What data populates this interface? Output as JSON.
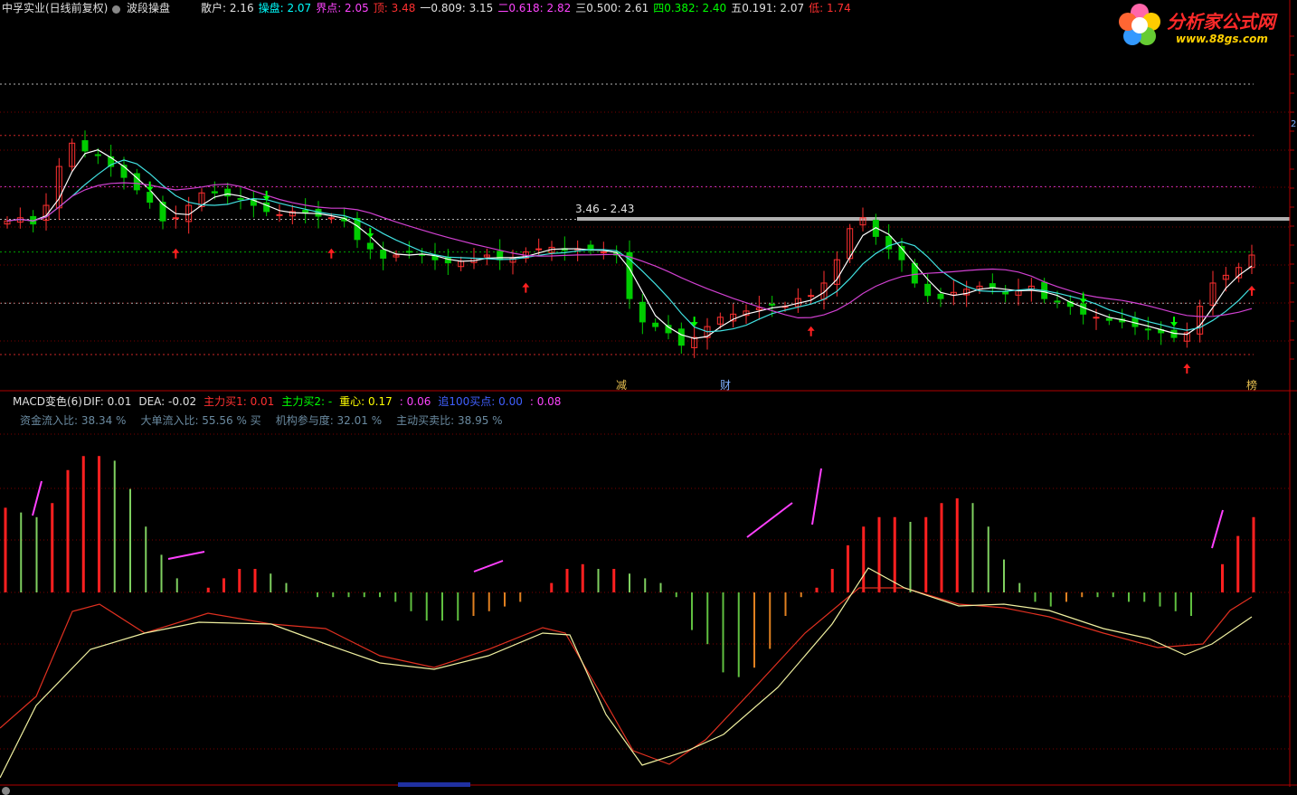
{
  "header": {
    "stock_title": "中孚实业(日线前复权)",
    "indicator_name": "波段操盘",
    "readouts": [
      {
        "label": "散户:",
        "value": "2.16",
        "color": "#e0e0e0"
      },
      {
        "label": "操盘:",
        "value": "2.07",
        "color": "#00ffff"
      },
      {
        "label": "界点:",
        "value": "2.05",
        "color": "#ff44ff"
      },
      {
        "label": "顶:",
        "value": "3.48",
        "color": "#ff3030"
      },
      {
        "label": "一0.809:",
        "value": "3.15",
        "color": "#e0e0e0"
      },
      {
        "label": "二0.618:",
        "value": "2.82",
        "color": "#ff44ff"
      },
      {
        "label": "三0.500:",
        "value": "2.61",
        "color": "#e0e0e0"
      },
      {
        "label": "四0.382:",
        "value": "2.40",
        "color": "#00ff00"
      },
      {
        "label": "五0.191:",
        "value": "2.07",
        "color": "#e0e0e0"
      },
      {
        "label": "低:",
        "value": "1.74",
        "color": "#ff3030"
      }
    ]
  },
  "logo": {
    "name": "分析家公式网",
    "url": "www.88gs.com"
  },
  "main_chart": {
    "annotation": "3.46 - 2.43",
    "markers": [
      "减",
      "财",
      "榜"
    ],
    "right_axis_tick": "2"
  },
  "sub_chart": {
    "title": "MACD变色(6)",
    "readouts": [
      {
        "label": "DIF:",
        "value": "0.01",
        "color": "#e0e0e0"
      },
      {
        "label": "DEA:",
        "value": "-0.02",
        "color": "#e0e0e0"
      },
      {
        "label": "主力买1:",
        "value": "0.01",
        "color": "#ff3030"
      },
      {
        "label": "主力买2:",
        "value": "-",
        "color": "#00ff00"
      },
      {
        "label": "重心:",
        "value": "0.17",
        "color": "#ffff00"
      },
      {
        "label": ":",
        "value": "0.06",
        "color": "#ff44ff"
      },
      {
        "label": "追100买点:",
        "value": "0.00",
        "color": "#4060ff"
      },
      {
        "label": ":",
        "value": "0.08",
        "color": "#ff44ff"
      }
    ],
    "stats": [
      {
        "label": "资金流入比:",
        "value": "38.34 %"
      },
      {
        "label": "大单流入比:",
        "value": "55.56 % 买"
      },
      {
        "label": "机构参与度:",
        "value": "32.01 %"
      },
      {
        "label": "主动买卖比:",
        "value": "38.95 %"
      }
    ]
  },
  "chart_data": [
    {
      "type": "candlestick",
      "title": "波段操盘",
      "fib_levels": [
        {
          "name": "顶",
          "value": 3.48
        },
        {
          "name": "一0.809",
          "value": 3.15
        },
        {
          "name": "二0.618",
          "value": 2.82
        },
        {
          "name": "三0.500",
          "value": 2.61
        },
        {
          "name": "四0.382",
          "value": 2.4
        },
        {
          "name": "五0.191",
          "value": 2.07
        },
        {
          "name": "低",
          "value": 1.74
        }
      ],
      "closes": [
        2.6,
        2.62,
        2.58,
        2.7,
        2.95,
        3.1,
        3.05,
        3.02,
        2.95,
        2.88,
        2.8,
        2.72,
        2.6,
        2.62,
        2.7,
        2.78,
        2.78,
        2.76,
        2.74,
        2.7,
        2.66,
        2.64,
        2.66,
        2.65,
        2.63,
        2.62,
        2.6,
        2.48,
        2.42,
        2.36,
        2.38,
        2.4,
        2.38,
        2.35,
        2.33,
        2.34,
        2.36,
        2.38,
        2.35,
        2.36,
        2.4,
        2.42,
        2.43,
        2.41,
        2.42,
        2.41,
        2.4,
        2.38,
        2.1,
        1.95,
        1.92,
        1.88,
        1.8,
        1.85,
        1.92,
        1.98,
        2.0,
        2.02,
        2.04,
        2.06,
        2.05,
        2.1,
        2.12,
        2.2,
        2.35,
        2.55,
        2.62,
        2.5,
        2.42,
        2.35,
        2.2,
        2.12,
        2.1,
        2.14,
        2.16,
        2.18,
        2.17,
        2.13,
        2.15,
        2.18,
        2.1,
        2.08,
        2.05,
        2.0,
        1.98,
        1.96,
        1.95,
        1.92,
        1.9,
        1.88,
        1.85,
        1.88,
        2.05,
        2.2,
        2.25,
        2.3,
        2.38
      ]
    },
    {
      "type": "bar",
      "title": "MACD变色(6)",
      "series": [
        {
          "name": "DIF",
          "value": 0.01
        },
        {
          "name": "DEA",
          "value": -0.02
        }
      ],
      "macd_hist": [
        0.18,
        0.17,
        0.16,
        0.19,
        0.26,
        0.29,
        0.29,
        0.28,
        0.22,
        0.14,
        0.08,
        0.03,
        0.0,
        0.01,
        0.03,
        0.05,
        0.05,
        0.04,
        0.02,
        0.0,
        -0.01,
        -0.01,
        -0.01,
        -0.01,
        -0.01,
        -0.02,
        -0.04,
        -0.06,
        -0.06,
        -0.06,
        -0.05,
        -0.04,
        -0.03,
        -0.02,
        0.0,
        0.02,
        0.05,
        0.06,
        0.05,
        0.05,
        0.04,
        0.03,
        0.02,
        -0.01,
        -0.08,
        -0.11,
        -0.17,
        -0.18,
        -0.16,
        -0.12,
        -0.05,
        -0.01,
        0.01,
        0.05,
        0.1,
        0.14,
        0.16,
        0.16,
        0.15,
        0.16,
        0.19,
        0.2,
        0.19,
        0.14,
        0.07,
        0.02,
        -0.02,
        -0.03,
        -0.02,
        -0.01,
        -0.01,
        -0.01,
        -0.02,
        -0.02,
        -0.03,
        -0.04,
        -0.05,
        0.0,
        0.06,
        0.12,
        0.16
      ]
    }
  ]
}
